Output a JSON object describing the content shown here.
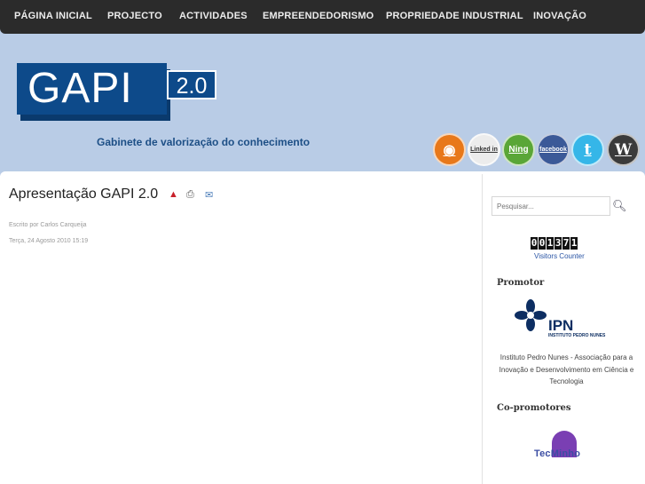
{
  "nav": {
    "items": [
      {
        "label": "PÁGINA INICIAL"
      },
      {
        "label": "PROJECTO"
      },
      {
        "label": "ACTIVIDADES"
      },
      {
        "label": "EMPREENDEDORISMO"
      },
      {
        "label": "PROPRIEDADE INDUSTRIAL"
      },
      {
        "label": "INOVAÇÃO"
      }
    ]
  },
  "header": {
    "logo_text": "GAPI",
    "logo_version": "2.0",
    "tagline": "Gabinete de valorização do conhecimento",
    "social": [
      {
        "name": "rss-icon",
        "glyph": "◉"
      },
      {
        "name": "linkedin-icon",
        "glyph": "Linked in"
      },
      {
        "name": "ning-icon",
        "glyph": "Ning"
      },
      {
        "name": "facebook-icon",
        "glyph": "facebook"
      },
      {
        "name": "twitter-icon",
        "glyph": "t"
      },
      {
        "name": "wordpress-icon",
        "glyph": "W"
      }
    ]
  },
  "article": {
    "title": "Apresentação GAPI 2.0",
    "icons": {
      "pdf": "▲",
      "print": "⎙",
      "email": "✉"
    },
    "author": "Escrito por Carlos Carqueija",
    "date": "Terça, 24 Agosto 2010 15:19"
  },
  "sidebar": {
    "search_placeholder": "Pesquisar...",
    "counter_digits": [
      "0",
      "0",
      "1",
      "3",
      "7",
      "1"
    ],
    "counter_label": "Visitors Counter",
    "promotor_heading": "Promotor",
    "ipn_logo_text": "IPN",
    "ipn_logo_sub": "INSTITUTO PEDRO NUNES",
    "promotor_desc": "Instituto Pedro Nunes - Associação para a Inovação e Desenvolvimento em Ciência e Tecnologia",
    "copromotores_heading": "Co-promotores",
    "tecminho_logo_text": "TecMinho"
  },
  "colors": {
    "nav_bg": "#2b2b2b",
    "page_bg": "#b9cce6",
    "logo_blue": "#0d4a8a",
    "tagline": "#1d4f86",
    "link_blue": "#2a55a5"
  }
}
